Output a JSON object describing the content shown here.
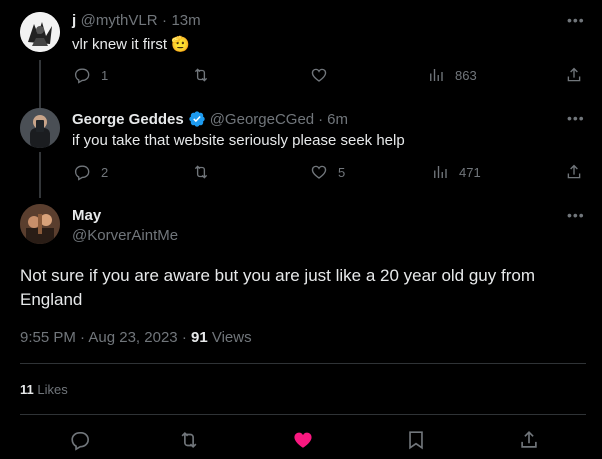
{
  "reply1": {
    "name": "j",
    "handle": "@mythVLR",
    "time": "13m",
    "text": "vlr knew it first",
    "emoji": "🫡",
    "replies": "1",
    "views": "863"
  },
  "reply2": {
    "name": "George Geddes",
    "handle": "@GeorgeCGed",
    "time": "6m",
    "text": "if you take that website seriously please seek help",
    "replies": "2",
    "likes": "5",
    "views": "471"
  },
  "main": {
    "name": "May",
    "handle": "@KorverAintMe",
    "text": "Not sure if you are aware but you are just like a 20 year old guy from England",
    "time": "9:55 PM",
    "date": "Aug 23, 2023",
    "separator": "·",
    "views_count": "91",
    "views_label": "Views",
    "likes_count": "11",
    "likes_label": "Likes"
  },
  "colors": {
    "background": "#000000",
    "text": "#e7e9ea",
    "muted": "#71767b",
    "verified": "#1d9bf0",
    "like_active": "#f91880"
  },
  "icons": {
    "more": "more-horizontal-icon",
    "reply": "reply-icon",
    "retweet": "retweet-icon",
    "like": "heart-icon",
    "views": "views-icon",
    "share": "share-icon",
    "bookmark": "bookmark-icon",
    "verified": "verified-badge-icon"
  }
}
